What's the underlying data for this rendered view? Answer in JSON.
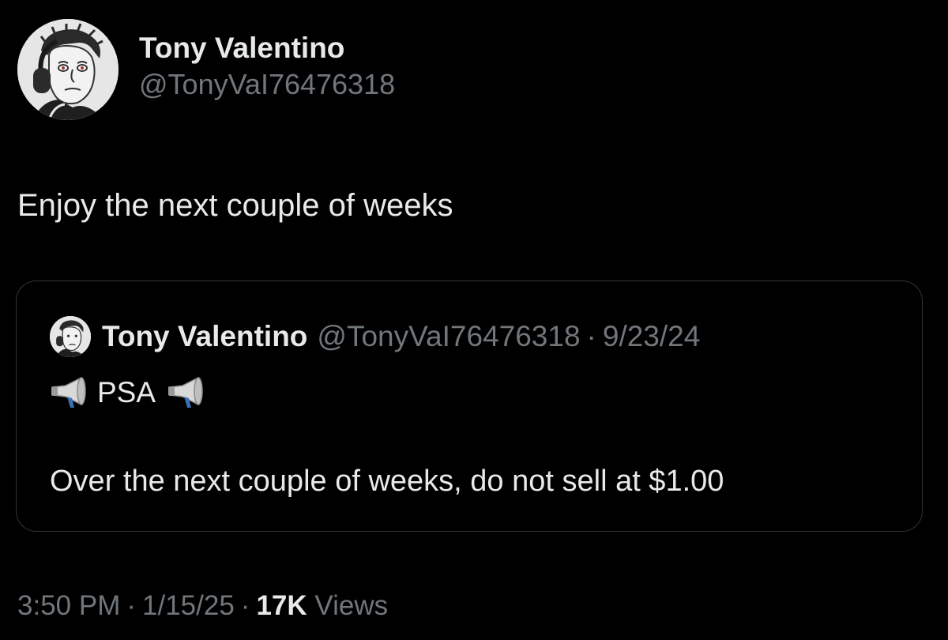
{
  "author": {
    "display_name": "Tony Valentino",
    "handle": "@TonyVaI76476318",
    "avatar_icon": "wojak-headphones-avatar"
  },
  "tweet": {
    "text": "Enjoy the next couple of weeks"
  },
  "quoted_tweet": {
    "display_name": "Tony Valentino",
    "handle": "@TonyVaI76476318",
    "separator": "·",
    "date": "9/23/24",
    "line1_text": "PSA",
    "line1_icon": "megaphone-emoji",
    "body_text": "Over the next couple of weeks, do not sell at $1.00"
  },
  "meta": {
    "time": "3:50 PM",
    "separator": "·",
    "date": "1/15/25",
    "views_count": "17K",
    "views_label": "Views"
  },
  "colors": {
    "background": "#000000",
    "primary_text": "#e7e9ea",
    "secondary_text": "#71767b",
    "border": "#2f3336"
  }
}
